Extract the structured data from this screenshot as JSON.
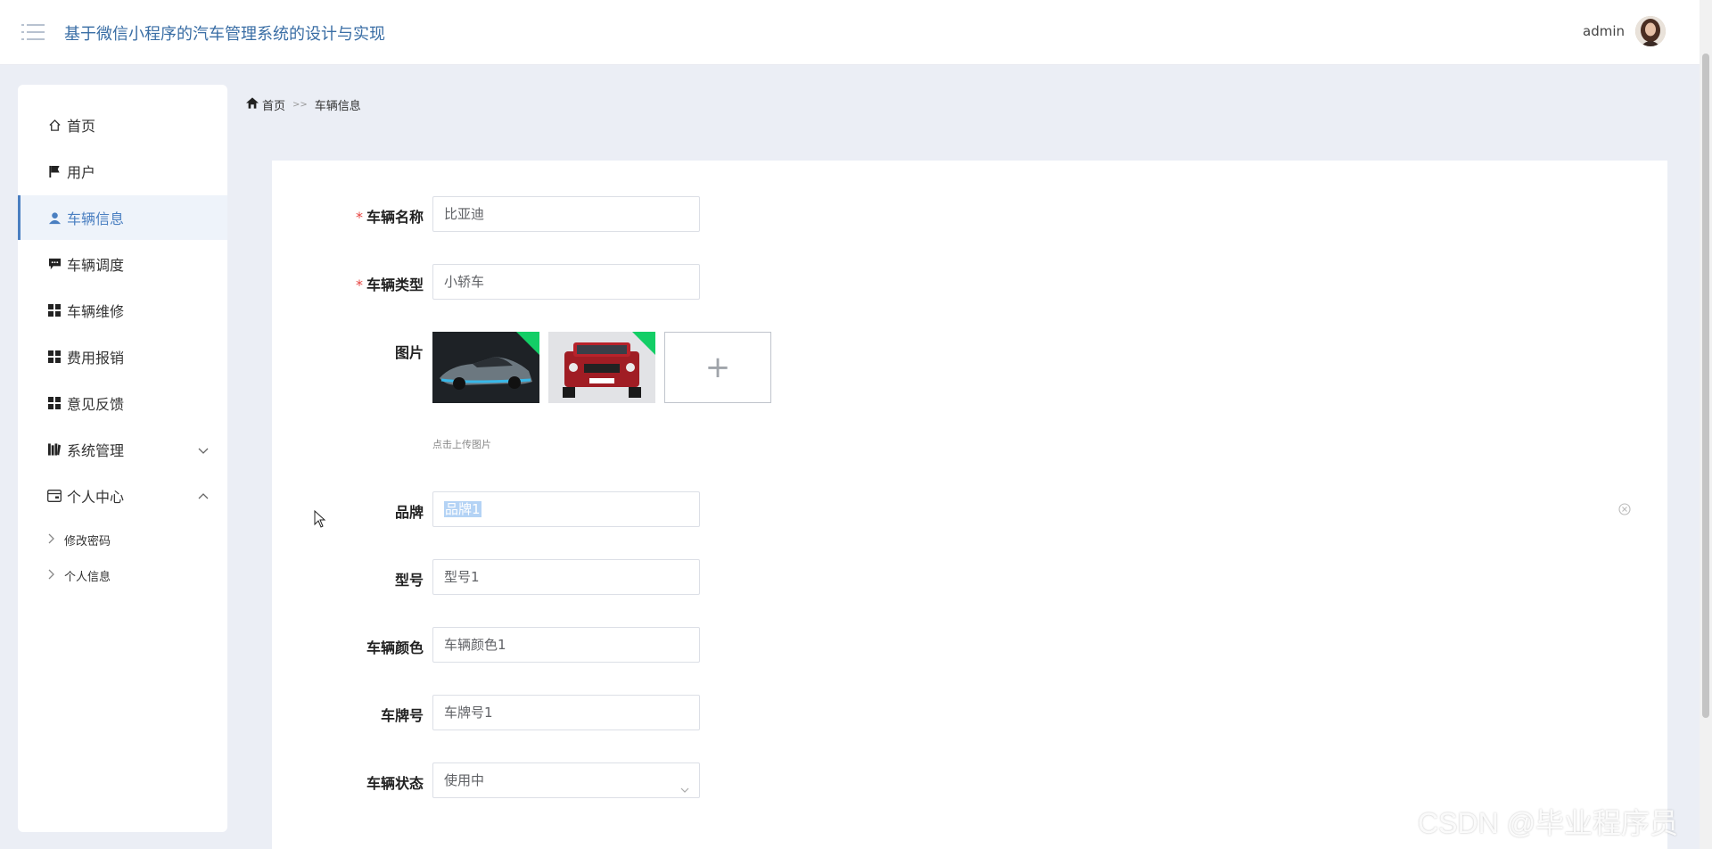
{
  "header": {
    "title": "基于微信小程序的汽车管理系统的设计与实现",
    "username": "admin"
  },
  "sidebar": {
    "items": [
      {
        "label": "首页",
        "icon": "home-icon"
      },
      {
        "label": "用户",
        "icon": "flag-icon"
      },
      {
        "label": "车辆信息",
        "icon": "person-icon",
        "active": true
      },
      {
        "label": "车辆调度",
        "icon": "chat-icon"
      },
      {
        "label": "车辆维修",
        "icon": "grid-icon"
      },
      {
        "label": "费用报销",
        "icon": "grid-icon"
      },
      {
        "label": "意见反馈",
        "icon": "grid-icon"
      },
      {
        "label": "系统管理",
        "icon": "book-icon",
        "expanded": false
      },
      {
        "label": "个人中心",
        "icon": "card-icon",
        "expanded": true
      }
    ],
    "sub_items": [
      {
        "label": "修改密码"
      },
      {
        "label": "个人信息"
      }
    ]
  },
  "breadcrumb": {
    "home": "首页",
    "separator": ">>",
    "current": "车辆信息"
  },
  "form": {
    "vehicle_name": {
      "label": "车辆名称",
      "value": "比亚迪",
      "required": true
    },
    "vehicle_type": {
      "label": "车辆类型",
      "value": "小轿车",
      "required": true
    },
    "image": {
      "label": "图片",
      "hint": "点击上传图片",
      "upload_symbol": "+"
    },
    "brand": {
      "label": "品牌",
      "value": "品牌1"
    },
    "model": {
      "label": "型号",
      "value": "型号1"
    },
    "color": {
      "label": "车辆颜色",
      "value": "车辆颜色1"
    },
    "plate": {
      "label": "车牌号",
      "value": "车牌号1"
    },
    "status": {
      "label": "车辆状态",
      "value": "使用中"
    }
  },
  "watermark": "CSDN @毕业程序员",
  "colors": {
    "accent": "#4a7fc1",
    "required": "#e64340",
    "success_badge": "#13ce66",
    "background": "#ebeef5"
  }
}
